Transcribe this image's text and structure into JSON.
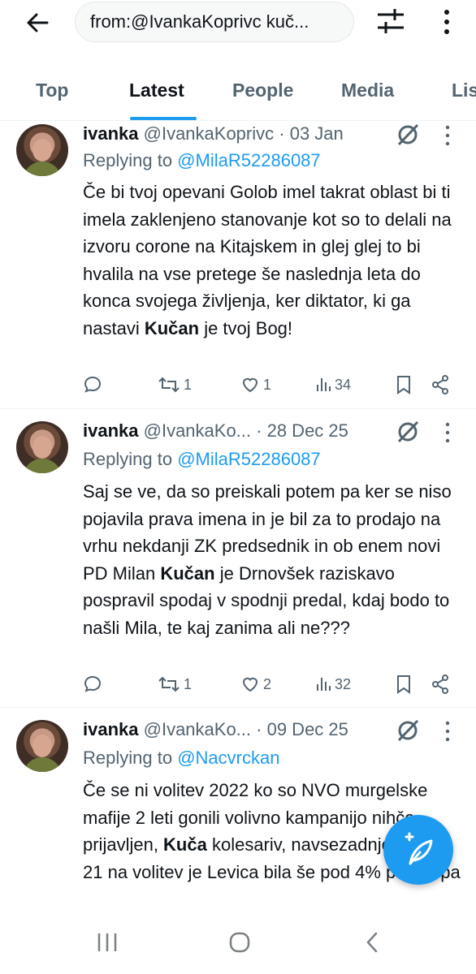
{
  "search": {
    "query": "from:@IvankaKoprivc kuč..."
  },
  "tabs": [
    {
      "label": "Top"
    },
    {
      "label": "Latest"
    },
    {
      "label": "People"
    },
    {
      "label": "Media"
    },
    {
      "label": "Lis"
    }
  ],
  "tweets": [
    {
      "name": "ivanka",
      "handle": "@IvankaKoprivc",
      "date": "· 03 Jan",
      "replying_prefix": "Replying to",
      "replying_to": "@MilaR52286087",
      "body_before": "Če bi tvoj opevani Golob imel takrat oblast bi ti imela zaklenjeno stanovanje kot so to delali na izvoru corone na Kitajskem in glej glej to bi hvalila na vse pretege še naslednja leta do konca svojega življenja, ker diktator, ki ga nastavi ",
      "body_bold": "Kučan",
      "body_after": " je tvoj Bog!",
      "reposts": "1",
      "likes": "1",
      "views": "34"
    },
    {
      "name": "ivanka",
      "handle": "@IvankaKo...",
      "date": "· 28 Dec 25",
      "replying_prefix": "Replying to",
      "replying_to": "@MilaR52286087",
      "body_before": "Saj se ve, da so preiskali potem pa ker se niso pojavila prava imena in je bil za to prodajo na vrhu nekdanji ZK predsednik in ob enem novi PD Milan ",
      "body_bold": "Kučan",
      "body_after": " je Drnovšek raziskavo pospravil spodaj v spodnji predal, kdaj bodo to našli Mila, te kaj zanima ali ne???",
      "reposts": "1",
      "likes": "2",
      "views": "32"
    },
    {
      "name": "ivanka",
      "handle": "@IvankaKo...",
      "date": "· 09 Dec 25",
      "replying_prefix": "Replying to",
      "replying_to": "@Nacvrckan",
      "body_before": "Če se ni volitev 2022 ko so NVO murgelske mafije 2 leti gonili volivno kampanijo  nihče prijavljen,  ",
      "body_bold": "Kuča",
      "body_after": " kolesariv, navsezadnje pa ob 21 na volitev je Levica bila še pod 4% potem pa"
    }
  ],
  "colors": {
    "accent": "#1d9bf0",
    "text": "#0f1419",
    "muted": "#536471"
  },
  "icons": {
    "back": "arrow-left-icon",
    "filter": "sliders-icon",
    "more": "more-vertical-icon",
    "grok": "grok-icon",
    "reply": "reply-icon",
    "repost": "repost-icon",
    "like": "heart-icon",
    "views": "views-icon",
    "bookmark": "bookmark-icon",
    "share": "share-icon",
    "compose": "compose-post-icon"
  }
}
